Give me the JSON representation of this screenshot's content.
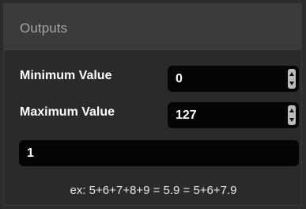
{
  "panel": {
    "title": "Outputs"
  },
  "minimum": {
    "label": "Minimum Value",
    "value": "0"
  },
  "maximum": {
    "label": "Maximum Value",
    "value": "127"
  },
  "expression": {
    "value": "1"
  },
  "hint": "ex: 5+6+7+8+9 = 5.9 = 5+6+7.9"
}
